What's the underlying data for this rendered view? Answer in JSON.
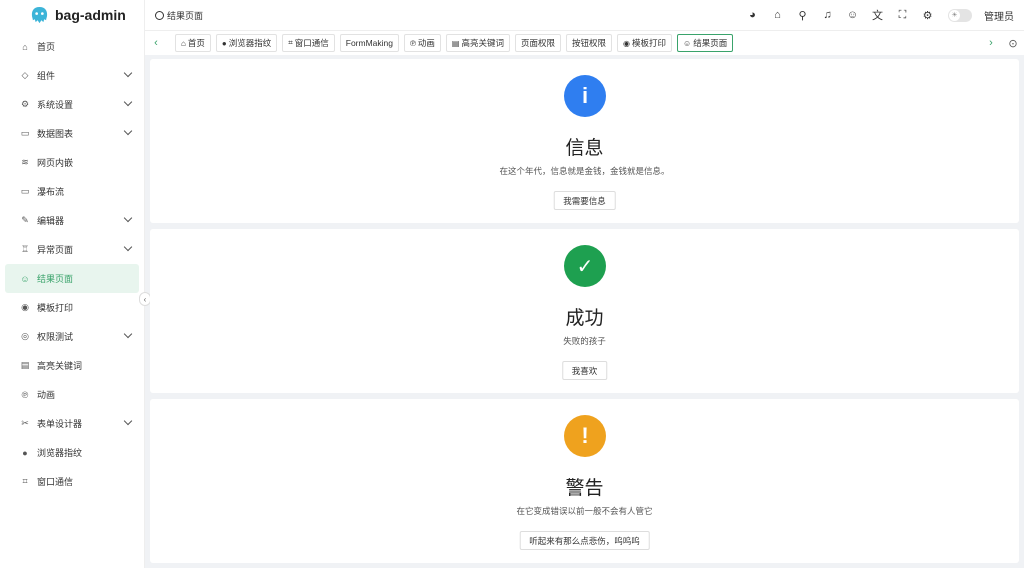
{
  "app": {
    "name": "bag-admin"
  },
  "sidebar": {
    "items": [
      {
        "label": "首页",
        "icon": "home-icon",
        "glyph": "⌂",
        "expandable": false
      },
      {
        "label": "组件",
        "icon": "cube-icon",
        "glyph": "◇",
        "expandable": true
      },
      {
        "label": "系统设置",
        "icon": "gear-icon",
        "glyph": "⚙",
        "expandable": true
      },
      {
        "label": "数据图表",
        "icon": "chart-icon",
        "glyph": "▭",
        "expandable": true
      },
      {
        "label": "网页内嵌",
        "icon": "layers-icon",
        "glyph": "≋",
        "expandable": false
      },
      {
        "label": "瀑布流",
        "icon": "monitor-icon",
        "glyph": "▭",
        "expandable": false
      },
      {
        "label": "编辑器",
        "icon": "edit-icon",
        "glyph": "✎",
        "expandable": true
      },
      {
        "label": "异常页面",
        "icon": "bug-icon",
        "glyph": "♖",
        "expandable": true
      },
      {
        "label": "结果页面",
        "icon": "smile-icon",
        "glyph": "☺",
        "expandable": false,
        "active": true
      },
      {
        "label": "模板打印",
        "icon": "record-icon",
        "glyph": "◉",
        "expandable": false
      },
      {
        "label": "权限测试",
        "icon": "instagram-icon",
        "glyph": "◎",
        "expandable": true
      },
      {
        "label": "高亮关键词",
        "icon": "keyboard-icon",
        "glyph": "▤",
        "expandable": false
      },
      {
        "label": "动画",
        "icon": "pinterest-icon",
        "glyph": "℗",
        "expandable": false
      },
      {
        "label": "表单设计器",
        "icon": "tools-icon",
        "glyph": "✂",
        "expandable": true
      },
      {
        "label": "浏览器指纹",
        "icon": "chrome-icon",
        "glyph": "●",
        "expandable": false
      },
      {
        "label": "窗口通信",
        "icon": "telescope-icon",
        "glyph": "⌗",
        "expandable": false
      }
    ]
  },
  "header": {
    "breadcrumb": "结果页面",
    "tools": [
      {
        "icon": "github-icon",
        "glyph": "◕"
      },
      {
        "icon": "home-icon",
        "glyph": "⌂"
      },
      {
        "icon": "search-icon",
        "glyph": "⚲"
      },
      {
        "icon": "bell-icon",
        "glyph": "♫"
      },
      {
        "icon": "smile-icon",
        "glyph": "☺"
      },
      {
        "icon": "translate-icon",
        "glyph": "文"
      },
      {
        "icon": "fullscreen-icon",
        "glyph": "⛶"
      },
      {
        "icon": "settings-icon",
        "glyph": "⚙"
      }
    ],
    "user": "管理员"
  },
  "tags": {
    "items": [
      {
        "label": "首页",
        "glyph": "⌂"
      },
      {
        "label": "浏览器指纹",
        "glyph": "●"
      },
      {
        "label": "窗口通信",
        "glyph": "⌗"
      },
      {
        "label": "FormMaking",
        "glyph": ""
      },
      {
        "label": "动画",
        "glyph": "℗"
      },
      {
        "label": "高亮关键词",
        "glyph": "▤"
      },
      {
        "label": "页面权限",
        "glyph": ""
      },
      {
        "label": "按钮权限",
        "glyph": ""
      },
      {
        "label": "模板打印",
        "glyph": "◉"
      },
      {
        "label": "结果页面",
        "glyph": "☺",
        "active": true
      }
    ]
  },
  "results": [
    {
      "type": "info",
      "title": "信息",
      "subtitle": "在这个年代，信息就是金钱，金钱就是信息。",
      "button": "我需要信息",
      "color": "#2f7ef0",
      "glyph": "i"
    },
    {
      "type": "success",
      "title": "成功",
      "subtitle": "失败的孩子",
      "button": "我喜欢",
      "color": "#1ea050",
      "glyph": "✓"
    },
    {
      "type": "warning",
      "title": "警告",
      "subtitle": "在它变成错误以前一般不会有人管它",
      "button": "听起来有那么点悲伤，呜呜呜",
      "color": "#efa21e",
      "glyph": "!"
    }
  ]
}
